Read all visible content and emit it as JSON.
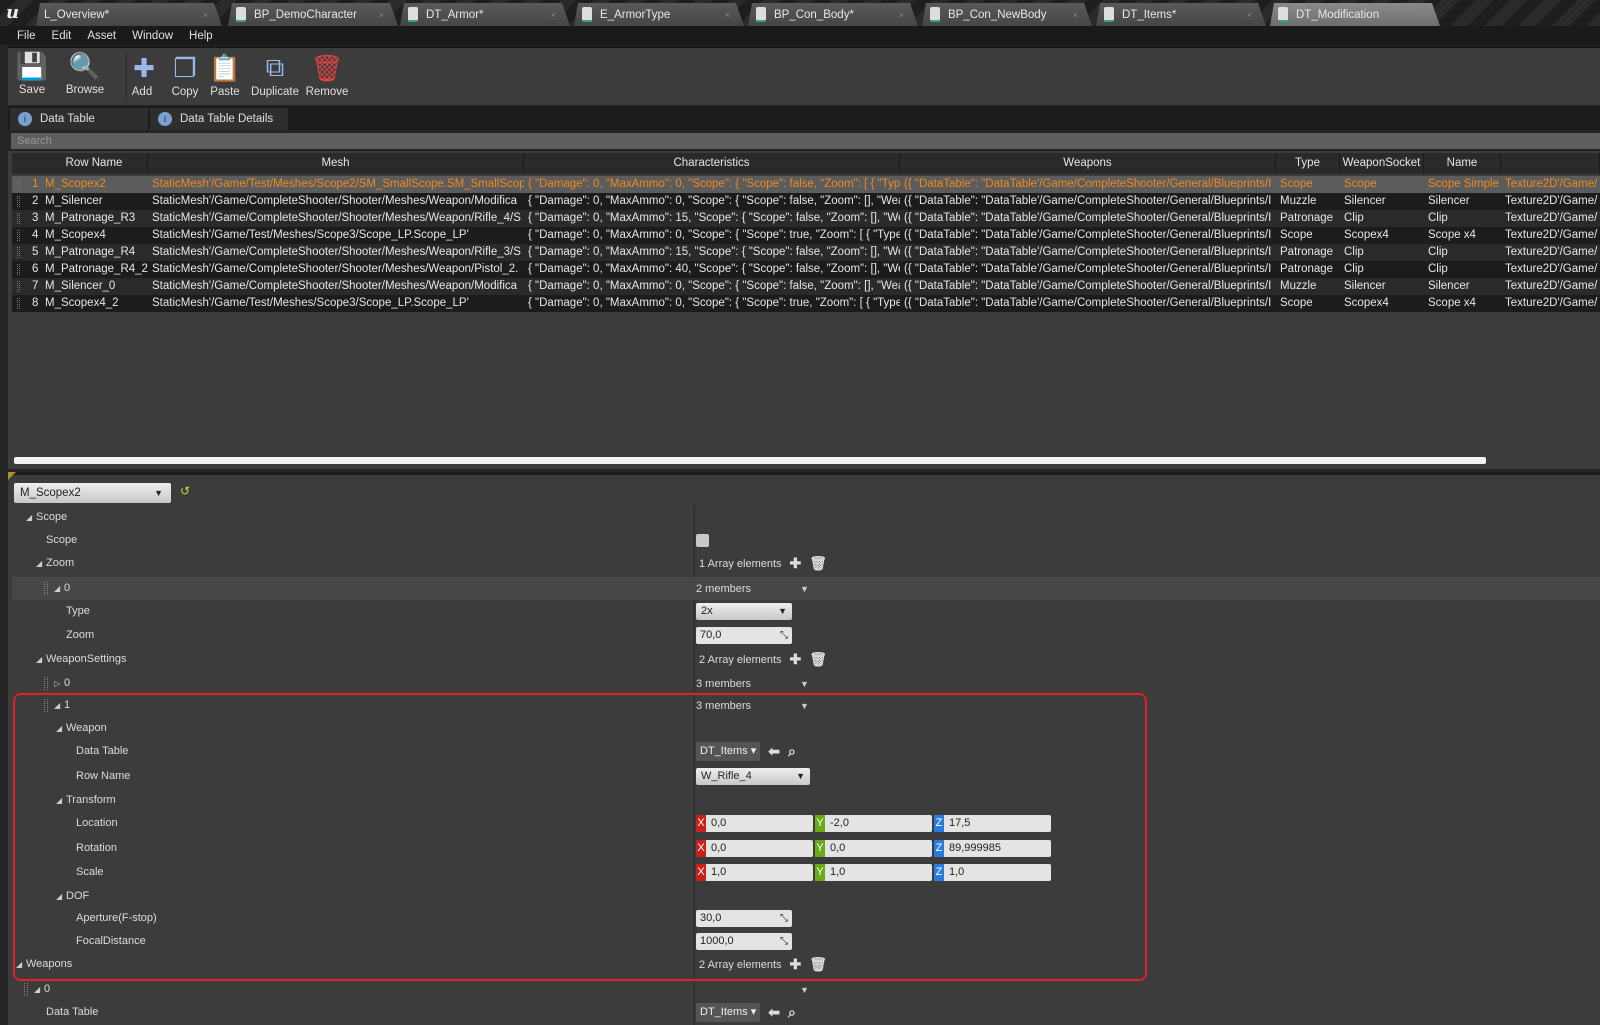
{
  "editor_tabs": [
    {
      "label": "L_Overview*",
      "active": false
    },
    {
      "label": "BP_DemoCharacter",
      "active": false
    },
    {
      "label": "DT_Armor*",
      "active": false
    },
    {
      "label": "E_ArmorType",
      "active": false
    },
    {
      "label": "BP_Con_Body*",
      "active": false
    },
    {
      "label": "BP_Con_NewBody",
      "active": false
    },
    {
      "label": "DT_Items*",
      "active": false
    },
    {
      "label": "DT_Modification",
      "active": true
    }
  ],
  "menu": [
    "File",
    "Edit",
    "Asset",
    "Window",
    "Help"
  ],
  "toolbar": [
    {
      "label": "Save",
      "icon": "floppy-icon"
    },
    {
      "label": "Browse",
      "icon": "magnifier-icon"
    },
    {
      "label": "Add",
      "icon": "plus-icon"
    },
    {
      "label": "Copy",
      "icon": "copy-icon"
    },
    {
      "label": "Paste",
      "icon": "clipboard-icon"
    },
    {
      "label": "Duplicate",
      "icon": "duplicate-icon"
    },
    {
      "label": "Remove",
      "icon": "trash-icon"
    }
  ],
  "panel_tabs": [
    "Data Table",
    "Data Table Details"
  ],
  "search": {
    "placeholder": "Search"
  },
  "table": {
    "columns": [
      "Row Name",
      "Mesh",
      "Characteristics",
      "Weapons",
      "Type",
      "WeaponSocket",
      "Name",
      ""
    ],
    "selected_row": 0,
    "rows": [
      [
        "1",
        "M_Scopex2",
        "StaticMesh'/Game/Test/Meshes/Scope2/SM_SmallScope.SM_SmallScope'",
        "{ \"Damage\": 0, \"MaxAmmo\": 0, \"Scope\": { \"Scope\": false, \"Zoom\": [ { \"Type\":",
        "({ \"DataTable\": \"DataTable'/Game/CompleteShooter/General/Blueprints/I",
        "Scope",
        "Scope",
        "Scope Simple",
        "Texture2D'/Game/"
      ],
      [
        "2",
        "M_Silencer",
        "StaticMesh'/Game/CompleteShooter/Shooter/Meshes/Weapon/Modifica",
        "{ \"Damage\": 0, \"MaxAmmo\": 0, \"Scope\": { \"Scope\": false, \"Zoom\": [], \"Weap",
        "({ \"DataTable\": \"DataTable'/Game/CompleteShooter/General/Blueprints/I",
        "Muzzle",
        "Silencer",
        "Silencer",
        "Texture2D'/Game/"
      ],
      [
        "3",
        "M_Patronage_R3",
        "StaticMesh'/Game/CompleteShooter/Shooter/Meshes/Weapon/Rifle_4/S",
        "{ \"Damage\": 0, \"MaxAmmo\": 15, \"Scope\": { \"Scope\": false, \"Zoom\": [], \"Wea",
        "({ \"DataTable\": \"DataTable'/Game/CompleteShooter/General/Blueprints/I",
        "Patronage",
        "Clip",
        "Clip",
        "Texture2D'/Game/"
      ],
      [
        "4",
        "M_Scopex4",
        "StaticMesh'/Game/Test/Meshes/Scope3/Scope_LP.Scope_LP'",
        "{ \"Damage\": 0, \"MaxAmmo\": 0, \"Scope\": { \"Scope\": true, \"Zoom\": [ { \"Type\":",
        "({ \"DataTable\": \"DataTable'/Game/CompleteShooter/General/Blueprints/I",
        "Scope",
        "Scopex4",
        "Scope x4",
        "Texture2D'/Game/"
      ],
      [
        "5",
        "M_Patronage_R4",
        "StaticMesh'/Game/CompleteShooter/Shooter/Meshes/Weapon/Rifle_3/S",
        "{ \"Damage\": 0, \"MaxAmmo\": 15, \"Scope\": { \"Scope\": false, \"Zoom\": [], \"Wea",
        "({ \"DataTable\": \"DataTable'/Game/CompleteShooter/General/Blueprints/I",
        "Patronage",
        "Clip",
        "Clip",
        "Texture2D'/Game/"
      ],
      [
        "6",
        "M_Patronage_R4_2",
        "StaticMesh'/Game/CompleteShooter/Shooter/Meshes/Weapon/Pistol_2.",
        "{ \"Damage\": 0, \"MaxAmmo\": 40, \"Scope\": { \"Scope\": false, \"Zoom\": [], \"Wea",
        "({ \"DataTable\": \"DataTable'/Game/CompleteShooter/General/Blueprints/I",
        "Patronage",
        "Clip",
        "Clip",
        "Texture2D'/Game/"
      ],
      [
        "7",
        "M_Silencer_0",
        "StaticMesh'/Game/CompleteShooter/Shooter/Meshes/Weapon/Modifica",
        "{ \"Damage\": 0, \"MaxAmmo\": 0, \"Scope\": { \"Scope\": false, \"Zoom\": [], \"Weap",
        "({ \"DataTable\": \"DataTable'/Game/CompleteShooter/General/Blueprints/I",
        "Muzzle",
        "Silencer",
        "Silencer",
        "Texture2D'/Game/"
      ],
      [
        "8",
        "M_Scopex4_2",
        "StaticMesh'/Game/Test/Meshes/Scope3/Scope_LP.Scope_LP'",
        "{ \"Damage\": 0, \"MaxAmmo\": 0, \"Scope\": { \"Scope\": true, \"Zoom\": [ { \"Type\":",
        "({ \"DataTable\": \"DataTable'/Game/CompleteShooter/General/Blueprints/I",
        "Scope",
        "Scopex4",
        "Scope x4",
        "Texture2D'/Game/"
      ]
    ]
  },
  "details": {
    "row_selector": "M_Scopex2",
    "properties": [
      {
        "label": "Scope",
        "depth": 0,
        "expander": "expanded"
      },
      {
        "label": "Scope",
        "depth": 1,
        "value": {
          "kind": "checkbox",
          "checked": false
        }
      },
      {
        "label": "Zoom",
        "depth": 1,
        "expander": "expanded",
        "value": {
          "kind": "array",
          "text": "1 Array elements"
        }
      },
      {
        "label": "0",
        "depth": 2,
        "expander": "expanded",
        "handle": true,
        "highlight": true,
        "value": {
          "kind": "members",
          "text": "2 members"
        }
      },
      {
        "label": "Type",
        "depth": 3,
        "value": {
          "kind": "combo",
          "text": "2x"
        }
      },
      {
        "label": "Zoom",
        "depth": 3,
        "value": {
          "kind": "number",
          "text": "70,0"
        }
      },
      {
        "label": "WeaponSettings",
        "depth": 1,
        "expander": "expanded",
        "value": {
          "kind": "array",
          "text": "2 Array elements"
        }
      },
      {
        "label": "0",
        "depth": 2,
        "expander": "collapsed",
        "handle": true,
        "value": {
          "kind": "members",
          "text": "3 members"
        }
      },
      {
        "label": "1",
        "depth": 2,
        "expander": "expanded",
        "handle": true,
        "value": {
          "kind": "members",
          "text": "3 members"
        }
      },
      {
        "label": "Weapon",
        "depth": 3,
        "expander": "expanded"
      },
      {
        "label": "Data Table",
        "depth": 4,
        "value": {
          "kind": "asset",
          "text": "DT_Items"
        }
      },
      {
        "label": "Row Name",
        "depth": 4,
        "value": {
          "kind": "combo",
          "text": "W_Rifle_4"
        }
      },
      {
        "label": "Transform",
        "depth": 3,
        "expander": "expanded"
      },
      {
        "label": "Location",
        "depth": 4,
        "value": {
          "kind": "vector",
          "x": "0,0",
          "y": "-2,0",
          "z": "17,5"
        }
      },
      {
        "label": "Rotation",
        "depth": 4,
        "value": {
          "kind": "vector",
          "x": "0,0",
          "y": "0,0",
          "z": "89,999985"
        }
      },
      {
        "label": "Scale",
        "depth": 4,
        "value": {
          "kind": "vector",
          "x": "1,0",
          "y": "1,0",
          "z": "1,0"
        }
      },
      {
        "label": "DOF",
        "depth": 3,
        "expander": "expanded"
      },
      {
        "label": "Aperture(F-stop)",
        "depth": 4,
        "value": {
          "kind": "number",
          "text": "30,0"
        }
      },
      {
        "label": "FocalDistance",
        "depth": 4,
        "value": {
          "kind": "number",
          "text": "1000,0"
        }
      },
      {
        "label": "Weapons",
        "depth": -1,
        "expander": "expanded",
        "value": {
          "kind": "array",
          "text": "2 Array elements"
        }
      },
      {
        "label": "0",
        "depth": 0,
        "expander": "expanded",
        "handle": true,
        "value": {
          "kind": "members",
          "text": ""
        }
      },
      {
        "label": "Data Table",
        "depth": 1,
        "value": {
          "kind": "asset",
          "text": "DT_Items"
        }
      }
    ]
  },
  "colors": {
    "selected_row_text": "#f08a1e",
    "axis_x": "#c8201a",
    "axis_y": "#6aaa1a",
    "axis_z": "#2a7ae0",
    "highlight_box": "#e0202a"
  }
}
